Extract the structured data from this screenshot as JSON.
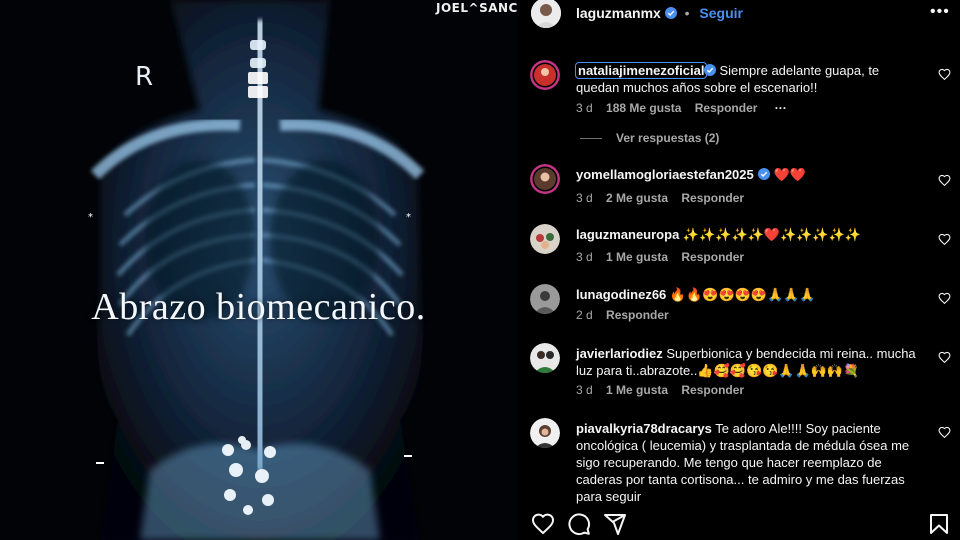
{
  "media": {
    "caption": "Abrazo biomecanico.",
    "marker": "R",
    "watermark": "JOEL^SANCHE"
  },
  "header": {
    "username": "laguzmanmx",
    "follow_label": "Seguir",
    "more_icon": "more-horizontal-icon"
  },
  "comments": [
    {
      "username": "nataliajimenezoficial",
      "verified": true,
      "text": "Siempre adelante guapa, te quedan muchos años sobre el escenario!!",
      "time": "3 d",
      "likes": "188 Me gusta",
      "reply": "Responder",
      "more": "···",
      "view_replies": "Ver respuestas (2)"
    },
    {
      "username": "yomellamogloriaestefan2025",
      "verified": true,
      "text": "❤️❤️",
      "time": "3 d",
      "likes": "2 Me gusta",
      "reply": "Responder"
    },
    {
      "username": "laguzmaneuropa",
      "verified": false,
      "text": "✨✨✨✨✨❤️✨✨✨✨✨",
      "time": "3 d",
      "likes": "1 Me gusta",
      "reply": "Responder"
    },
    {
      "username": "lunagodinez66",
      "verified": false,
      "text": "🔥🔥😍😍😍😍🙏🙏🙏",
      "time": "2 d",
      "reply": "Responder"
    },
    {
      "username": "javierlariodiez",
      "verified": false,
      "text": "Superbionica y bendecida mi reina.. mucha luz para ti..abrazote..👍🥰🥰😘😘🙏🙏🙌🙌💐",
      "time": "3 d",
      "likes": "1 Me gusta",
      "reply": "Responder"
    },
    {
      "username": "piavalkyria78dracarys",
      "verified": false,
      "text": "Te adoro Ale!!!! Soy paciente oncológica ( leucemia) y trasplantada de médula ósea me sigo recuperando. Me tengo que hacer reemplazo de caderas por tanta cortisona... te admiro y me das fuerzas para seguir"
    }
  ],
  "actions": {
    "like_icon": "heart-icon",
    "comment_icon": "comment-icon",
    "share_icon": "share-icon",
    "save_icon": "bookmark-icon"
  },
  "colors": {
    "accent": "#4a90f0",
    "background": "#000000",
    "muted": "#a8a8a8",
    "xray": "#8fc3e8"
  }
}
